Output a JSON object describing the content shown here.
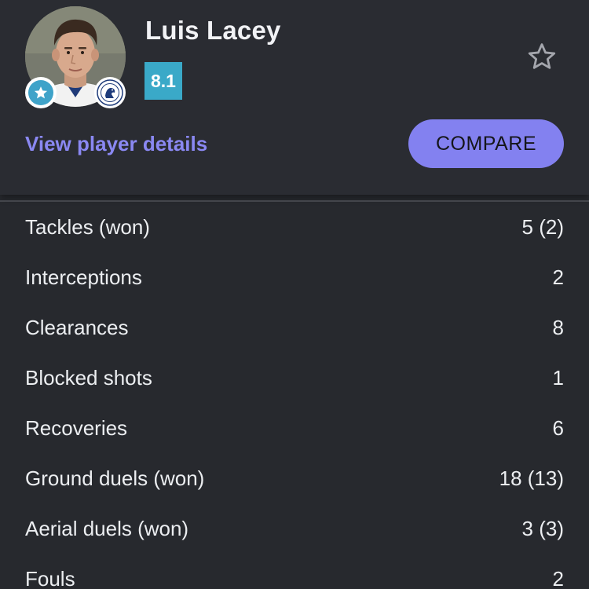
{
  "player": {
    "name": "Luis Lacey",
    "rating": "8.1",
    "view_details_label": "View player details",
    "compare_label": "COMPARE",
    "rating_color": "#3aa9c8",
    "accent_color": "#8381f0"
  },
  "icons": {
    "favorite": "star-outline-icon",
    "player_badge": "star-badge-icon",
    "club_badge": "club-crest-icon"
  },
  "stats": [
    {
      "label": "Tackles (won)",
      "value": "5 (2)"
    },
    {
      "label": "Interceptions",
      "value": "2"
    },
    {
      "label": "Clearances",
      "value": "8"
    },
    {
      "label": "Blocked shots",
      "value": "1"
    },
    {
      "label": "Recoveries",
      "value": "6"
    },
    {
      "label": "Ground duels (won)",
      "value": "18 (13)"
    },
    {
      "label": "Aerial duels (won)",
      "value": "3 (3)"
    },
    {
      "label": "Fouls",
      "value": "2"
    }
  ]
}
